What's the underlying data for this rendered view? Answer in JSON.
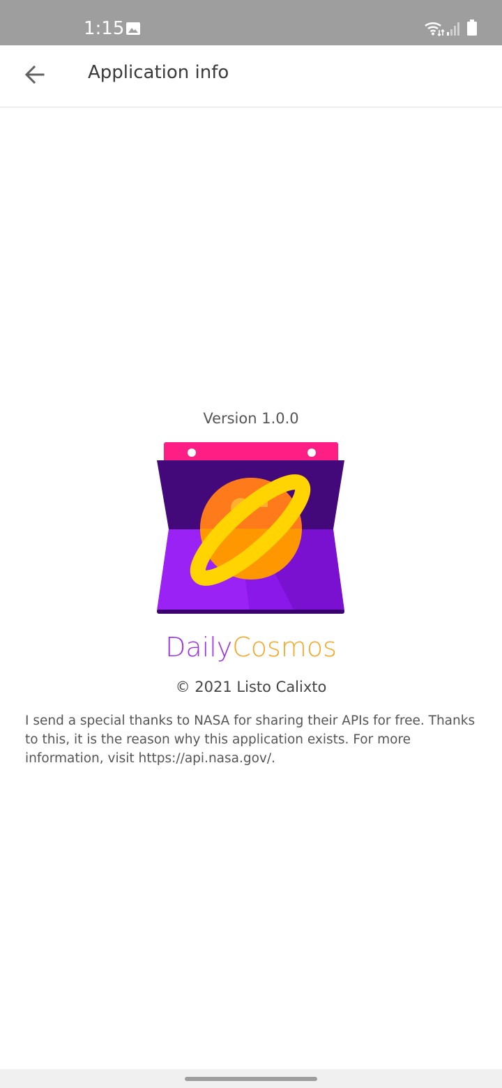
{
  "status_bar": {
    "time": "1:15",
    "icons": [
      "gallery-icon",
      "wifi-icon",
      "signal-icon",
      "battery-icon"
    ]
  },
  "app_bar": {
    "back_icon": "arrow-left-icon",
    "title": "Application info"
  },
  "content": {
    "version": "Version 1.0.0",
    "app_name_part1": "Daily",
    "app_name_part2": "Cosmos",
    "copyright": "© 2021 Listo Calixto",
    "thanks": "I send a special thanks to NASA for sharing their APIs for free. Thanks to this, it is the reason why this application exists. For more information, visit https://api.nasa.gov/."
  },
  "colors": {
    "status_bar": "#9e9e9e",
    "app_name_daily": "#9b30e6",
    "app_name_cosmos": "#f5a623",
    "logo_pink": "#ff1f84",
    "logo_dark_purple": "#43087a",
    "logo_purple": "#8a18e8",
    "logo_orange": "#ff9800",
    "logo_yellow": "#ffd400"
  }
}
